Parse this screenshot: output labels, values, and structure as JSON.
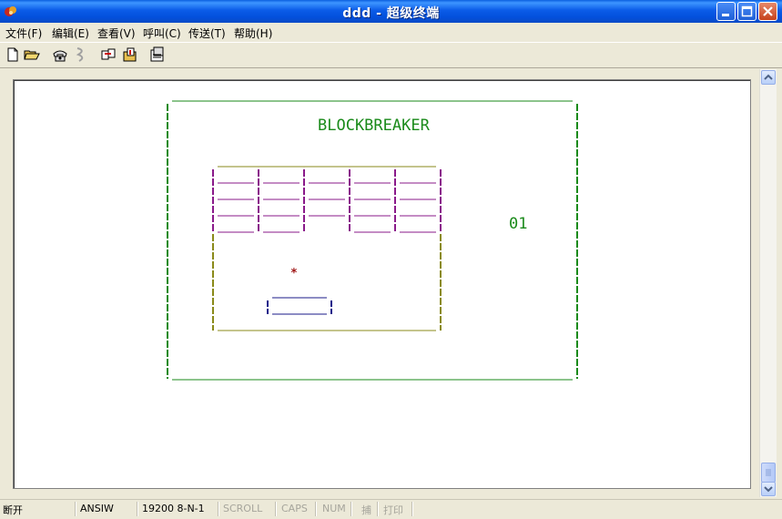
{
  "window": {
    "title": "ddd - 超级终端"
  },
  "menu": [
    "文件(F)",
    "编辑(E)",
    "查看(V)",
    "呼叫(C)",
    "传送(T)",
    "帮助(H)"
  ],
  "toolbar": {
    "icons": [
      "new-icon",
      "open-icon",
      "dial-icon",
      "disconnect-icon",
      "send-icon",
      "receive-icon",
      "properties-icon"
    ]
  },
  "terminal": {
    "game_title": "BLOCKBREAKER",
    "score": "01",
    "ball": "*",
    "colors": {
      "frame": "#1a8a1a",
      "bricks": "#8a1a8a",
      "walls": "#8a8a1a",
      "paddle": "#1a1a8a",
      "ball": "#a01818"
    }
  },
  "status": {
    "connection": "断开",
    "emulation": "ANSIW",
    "settings": "19200 8-N-1",
    "scroll": "SCROLL",
    "caps": "CAPS",
    "num": "NUM",
    "capture": "捕",
    "print": "打印"
  }
}
